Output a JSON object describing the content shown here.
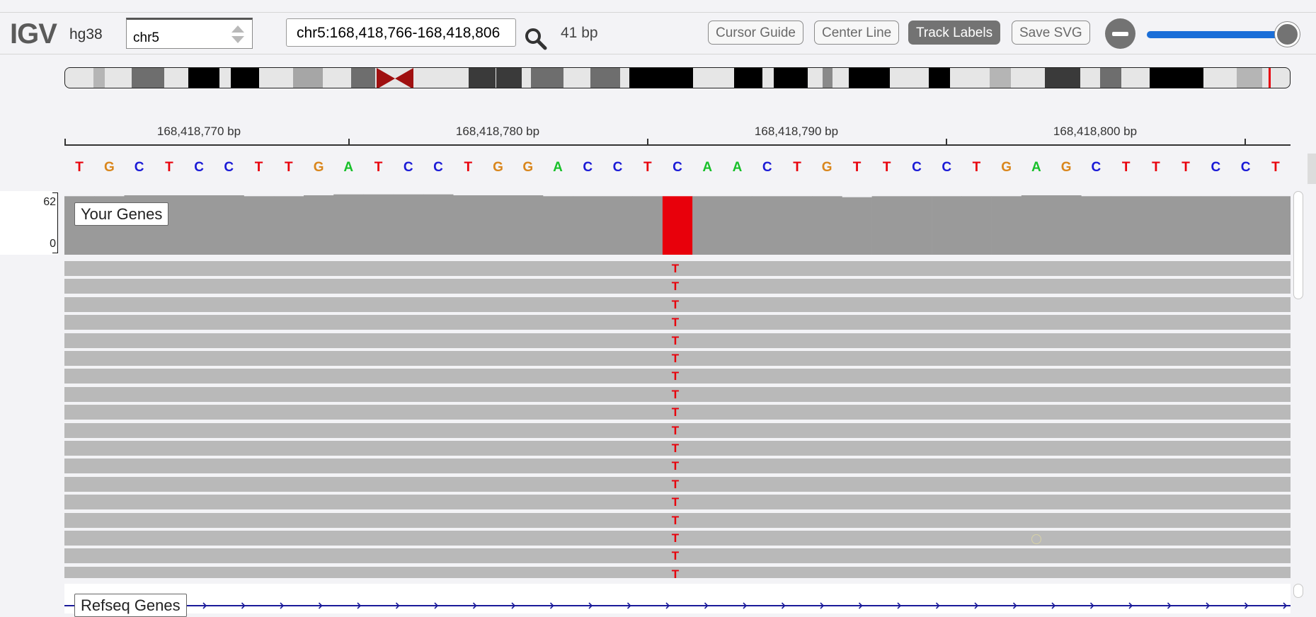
{
  "app": {
    "logo": "IGV",
    "genome": "hg38",
    "chromosome": "chr5",
    "locus": "chr5:168,418,766-168,418,806",
    "width_label": "41 bp"
  },
  "toolbar": {
    "buttons": [
      {
        "label": "Cursor Guide",
        "active": false
      },
      {
        "label": "Center Line",
        "active": false
      },
      {
        "label": "Track Labels",
        "active": true
      },
      {
        "label": "Save SVG",
        "active": false
      }
    ],
    "zoom_level": 1.0
  },
  "ruler": {
    "ticks": [
      {
        "label": "168,418,770 bp"
      },
      {
        "label": "168,418,780 bp"
      },
      {
        "label": "168,418,790 bp"
      },
      {
        "label": "168,418,800 bp"
      }
    ]
  },
  "sequence": {
    "bases": "TGCTCCTTGATCCTGGACCTCAACTGTTCCTGAGCTTTCCT",
    "colors": {
      "A": "#18c02a",
      "C": "#1a1ad6",
      "G": "#d9861c",
      "T": "#e8000b"
    }
  },
  "coverage": {
    "label": "Your Genes",
    "max": "62",
    "min": "0",
    "values": [
      62,
      62,
      63,
      63,
      63,
      63,
      62,
      62,
      63,
      64,
      64,
      64,
      64,
      63,
      63,
      63,
      62,
      62,
      62,
      62,
      62,
      62,
      62,
      62,
      62,
      62,
      61,
      62,
      62,
      62,
      62,
      62,
      63,
      63,
      62,
      62,
      62,
      62,
      62,
      62,
      62
    ],
    "mismatch_index": 20,
    "bar_color": "#9a9a9a",
    "mismatch_color": "#e8000b"
  },
  "alignments": {
    "mismatch_base": "T",
    "rows": 18,
    "read_color": "#b9b9b9"
  },
  "refseq": {
    "label": "Refseq Genes"
  }
}
